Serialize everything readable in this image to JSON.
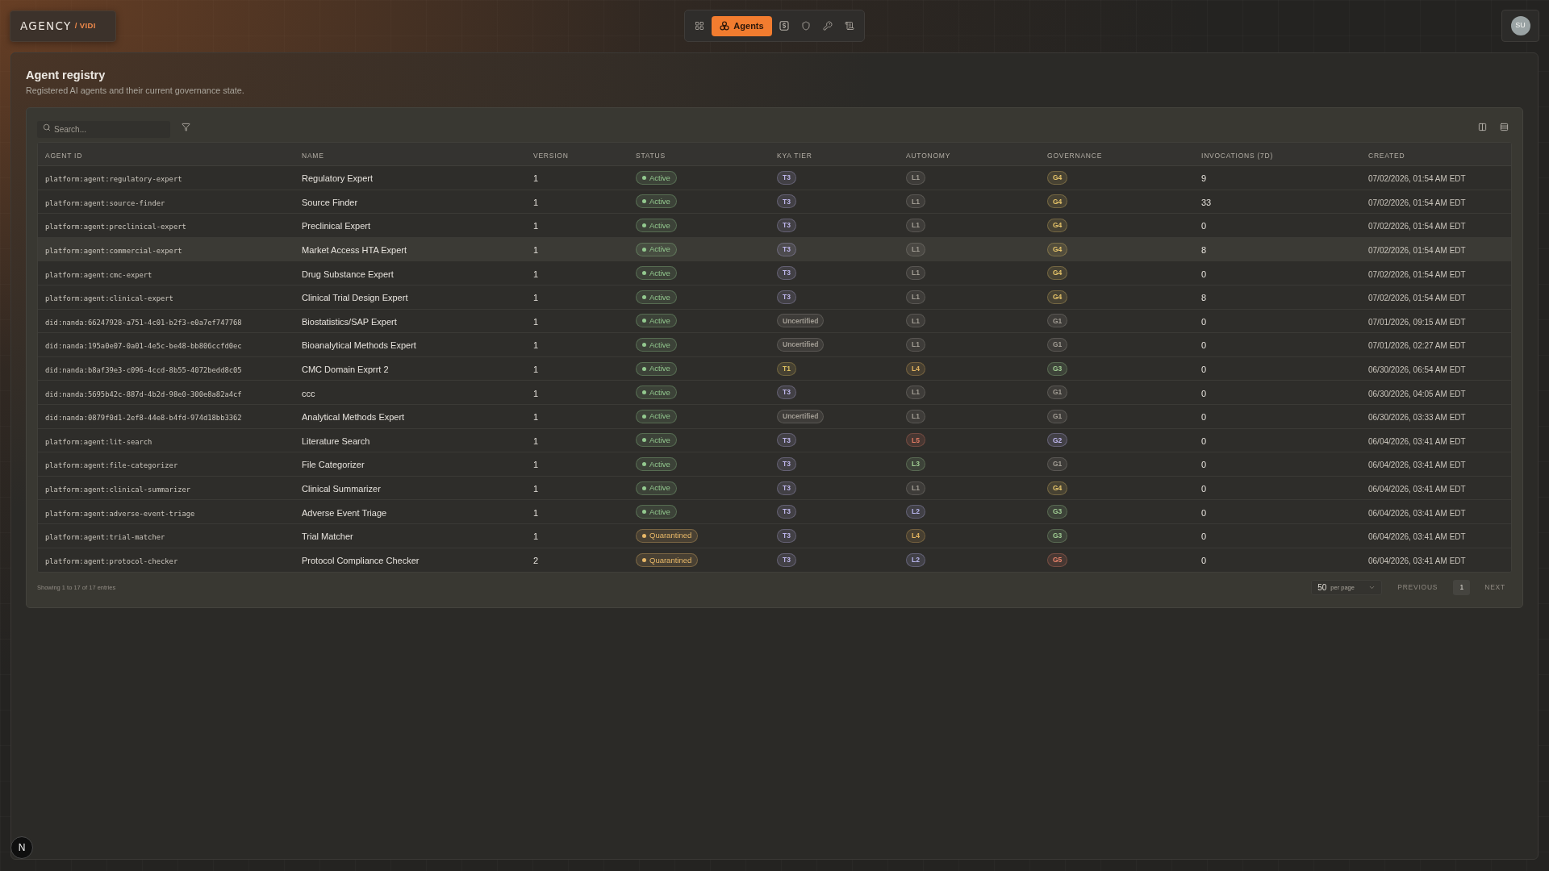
{
  "brand": {
    "name": "AGENCY",
    "product": "/ VIDI"
  },
  "nav": [
    {
      "selected": false
    },
    {
      "label": "Agents",
      "selected": true
    },
    {
      "selected": false
    },
    {
      "selected": false
    },
    {
      "selected": false
    },
    {
      "selected": false
    }
  ],
  "user": {
    "initials": "SU"
  },
  "page": {
    "title": "Agent registry",
    "subtitle": "Registered AI agents and their current governance state."
  },
  "toolbar": {
    "search": {
      "placeholder": "Search..."
    }
  },
  "table": {
    "columns": [
      "AGENT ID",
      "NAME",
      "VERSION",
      "STATUS",
      "KYA TIER",
      "AUTONOMY",
      "GOVERNANCE",
      "INVOCATIONS (7D)",
      "CREATED"
    ],
    "rows": [
      {
        "agent_id": "platform:agent:regulatory-expert",
        "name": "Regulatory Expert",
        "version": "1",
        "status": {
          "label": "Active",
          "color": "#93c98f"
        },
        "kya_tier": {
          "label": "T3",
          "color": "#bdb5ea"
        },
        "autonomy": {
          "label": "L1",
          "color": "#a19c93"
        },
        "governance": {
          "label": "G4",
          "color": "#e6c46a"
        },
        "invocations": "9",
        "created": "07/02/2026, 01:54 AM EDT",
        "selected": false
      },
      {
        "agent_id": "platform:agent:source-finder",
        "name": "Source Finder",
        "version": "1",
        "status": {
          "label": "Active",
          "color": "#93c98f"
        },
        "kya_tier": {
          "label": "T3",
          "color": "#bdb5ea"
        },
        "autonomy": {
          "label": "L1",
          "color": "#a19c93"
        },
        "governance": {
          "label": "G4",
          "color": "#e6c46a"
        },
        "invocations": "33",
        "created": "07/02/2026, 01:54 AM EDT",
        "selected": false
      },
      {
        "agent_id": "platform:agent:preclinical-expert",
        "name": "Preclinical Expert",
        "version": "1",
        "status": {
          "label": "Active",
          "color": "#93c98f"
        },
        "kya_tier": {
          "label": "T3",
          "color": "#bdb5ea"
        },
        "autonomy": {
          "label": "L1",
          "color": "#a19c93"
        },
        "governance": {
          "label": "G4",
          "color": "#e6c46a"
        },
        "invocations": "0",
        "created": "07/02/2026, 01:54 AM EDT",
        "selected": false
      },
      {
        "agent_id": "platform:agent:commercial-expert",
        "name": "Market Access HTA Expert",
        "version": "1",
        "status": {
          "label": "Active",
          "color": "#93c98f"
        },
        "kya_tier": {
          "label": "T3",
          "color": "#bdb5ea"
        },
        "autonomy": {
          "label": "L1",
          "color": "#a19c93"
        },
        "governance": {
          "label": "G4",
          "color": "#e6c46a"
        },
        "invocations": "8",
        "created": "07/02/2026, 01:54 AM EDT",
        "selected": true
      },
      {
        "agent_id": "platform:agent:cmc-expert",
        "name": "Drug Substance Expert",
        "version": "1",
        "status": {
          "label": "Active",
          "color": "#93c98f"
        },
        "kya_tier": {
          "label": "T3",
          "color": "#bdb5ea"
        },
        "autonomy": {
          "label": "L1",
          "color": "#a19c93"
        },
        "governance": {
          "label": "G4",
          "color": "#e6c46a"
        },
        "invocations": "0",
        "created": "07/02/2026, 01:54 AM EDT",
        "selected": false
      },
      {
        "agent_id": "platform:agent:clinical-expert",
        "name": "Clinical Trial Design Expert",
        "version": "1",
        "status": {
          "label": "Active",
          "color": "#93c98f"
        },
        "kya_tier": {
          "label": "T3",
          "color": "#bdb5ea"
        },
        "autonomy": {
          "label": "L1",
          "color": "#a19c93"
        },
        "governance": {
          "label": "G4",
          "color": "#e6c46a"
        },
        "invocations": "8",
        "created": "07/02/2026, 01:54 AM EDT",
        "selected": false
      },
      {
        "agent_id": "did:nanda:66247928-a751-4c01-b2f3-e0a7ef747768",
        "name": "Biostatistics/SAP Expert",
        "version": "1",
        "status": {
          "label": "Active",
          "color": "#93c98f"
        },
        "kya_tier": {
          "label": "Uncertified",
          "color": "#a19c93"
        },
        "autonomy": {
          "label": "L1",
          "color": "#a19c93"
        },
        "governance": {
          "label": "G1",
          "color": "#a19c93"
        },
        "invocations": "0",
        "created": "07/01/2026, 09:15 AM EDT",
        "selected": false
      },
      {
        "agent_id": "did:nanda:195a0e07-0a01-4e5c-be48-bb806ccfd0ec",
        "name": "Bioanalytical Methods Expert",
        "version": "1",
        "status": {
          "label": "Active",
          "color": "#93c98f"
        },
        "kya_tier": {
          "label": "Uncertified",
          "color": "#a19c93"
        },
        "autonomy": {
          "label": "L1",
          "color": "#a19c93"
        },
        "governance": {
          "label": "G1",
          "color": "#a19c93"
        },
        "invocations": "0",
        "created": "07/01/2026, 02:27 AM EDT",
        "selected": false
      },
      {
        "agent_id": "did:nanda:b8af39e3-c096-4ccd-8b55-4072bedd8c05",
        "name": "CMC Domain Exprrt 2",
        "version": "1",
        "status": {
          "label": "Active",
          "color": "#93c98f"
        },
        "kya_tier": {
          "label": "T1",
          "color": "#dcc060"
        },
        "autonomy": {
          "label": "L4",
          "color": "#e3b45f"
        },
        "governance": {
          "label": "G3",
          "color": "#9fcb92"
        },
        "invocations": "0",
        "created": "06/30/2026, 06:54 AM EDT",
        "selected": false
      },
      {
        "agent_id": "did:nanda:5695b42c-887d-4b2d-98e0-300e8a82a4cf",
        "name": "ccc",
        "version": "1",
        "status": {
          "label": "Active",
          "color": "#93c98f"
        },
        "kya_tier": {
          "label": "T3",
          "color": "#bdb5ea"
        },
        "autonomy": {
          "label": "L1",
          "color": "#a19c93"
        },
        "governance": {
          "label": "G1",
          "color": "#a19c93"
        },
        "invocations": "0",
        "created": "06/30/2026, 04:05 AM EDT",
        "selected": false
      },
      {
        "agent_id": "did:nanda:0879f0d1-2ef8-44e8-b4fd-974d18bb3362",
        "name": "Analytical Methods Expert",
        "version": "1",
        "status": {
          "label": "Active",
          "color": "#93c98f"
        },
        "kya_tier": {
          "label": "Uncertified",
          "color": "#a19c93"
        },
        "autonomy": {
          "label": "L1",
          "color": "#a19c93"
        },
        "governance": {
          "label": "G1",
          "color": "#a19c93"
        },
        "invocations": "0",
        "created": "06/30/2026, 03:33 AM EDT",
        "selected": false
      },
      {
        "agent_id": "platform:agent:lit-search",
        "name": "Literature Search",
        "version": "1",
        "status": {
          "label": "Active",
          "color": "#93c98f"
        },
        "kya_tier": {
          "label": "T3",
          "color": "#bdb5ea"
        },
        "autonomy": {
          "label": "L5",
          "color": "#e07a63"
        },
        "governance": {
          "label": "G2",
          "color": "#c0b8f0"
        },
        "invocations": "0",
        "created": "06/04/2026, 03:41 AM EDT",
        "selected": false
      },
      {
        "agent_id": "platform:agent:file-categorizer",
        "name": "File Categorizer",
        "version": "1",
        "status": {
          "label": "Active",
          "color": "#93c98f"
        },
        "kya_tier": {
          "label": "T3",
          "color": "#bdb5ea"
        },
        "autonomy": {
          "label": "L3",
          "color": "#9fcb92"
        },
        "governance": {
          "label": "G1",
          "color": "#a19c93"
        },
        "invocations": "0",
        "created": "06/04/2026, 03:41 AM EDT",
        "selected": false
      },
      {
        "agent_id": "platform:agent:clinical-summarizer",
        "name": "Clinical Summarizer",
        "version": "1",
        "status": {
          "label": "Active",
          "color": "#93c98f"
        },
        "kya_tier": {
          "label": "T3",
          "color": "#bdb5ea"
        },
        "autonomy": {
          "label": "L1",
          "color": "#a19c93"
        },
        "governance": {
          "label": "G4",
          "color": "#e6c46a"
        },
        "invocations": "0",
        "created": "06/04/2026, 03:41 AM EDT",
        "selected": false
      },
      {
        "agent_id": "platform:agent:adverse-event-triage",
        "name": "Adverse Event Triage",
        "version": "1",
        "status": {
          "label": "Active",
          "color": "#93c98f"
        },
        "kya_tier": {
          "label": "T3",
          "color": "#bdb5ea"
        },
        "autonomy": {
          "label": "L2",
          "color": "#b9b6ee"
        },
        "governance": {
          "label": "G3",
          "color": "#9fcb92"
        },
        "invocations": "0",
        "created": "06/04/2026, 03:41 AM EDT",
        "selected": false
      },
      {
        "agent_id": "platform:agent:trial-matcher",
        "name": "Trial Matcher",
        "version": "1",
        "status": {
          "label": "Quarantined",
          "color": "#e8b868"
        },
        "kya_tier": {
          "label": "T3",
          "color": "#bdb5ea"
        },
        "autonomy": {
          "label": "L4",
          "color": "#e3b45f"
        },
        "governance": {
          "label": "G3",
          "color": "#9fcb92"
        },
        "invocations": "0",
        "created": "06/04/2026, 03:41 AM EDT",
        "selected": false
      },
      {
        "agent_id": "platform:agent:protocol-checker",
        "name": "Protocol Compliance Checker",
        "version": "2",
        "status": {
          "label": "Quarantined",
          "color": "#e8b868"
        },
        "kya_tier": {
          "label": "T3",
          "color": "#bdb5ea"
        },
        "autonomy": {
          "label": "L2",
          "color": "#b9b6ee"
        },
        "governance": {
          "label": "G5",
          "color": "#e8836a"
        },
        "invocations": "0",
        "created": "06/04/2026, 03:41 AM EDT",
        "selected": false
      }
    ]
  },
  "footer": {
    "summary": "Showing 1 to 17 of 17 entries",
    "per_page": {
      "value": "50",
      "label": "per page"
    },
    "previous": "PREVIOUS",
    "pages": [
      {
        "label": "1",
        "selected": true
      }
    ],
    "next": "NEXT"
  },
  "dev_indicator": {
    "label": "N"
  }
}
